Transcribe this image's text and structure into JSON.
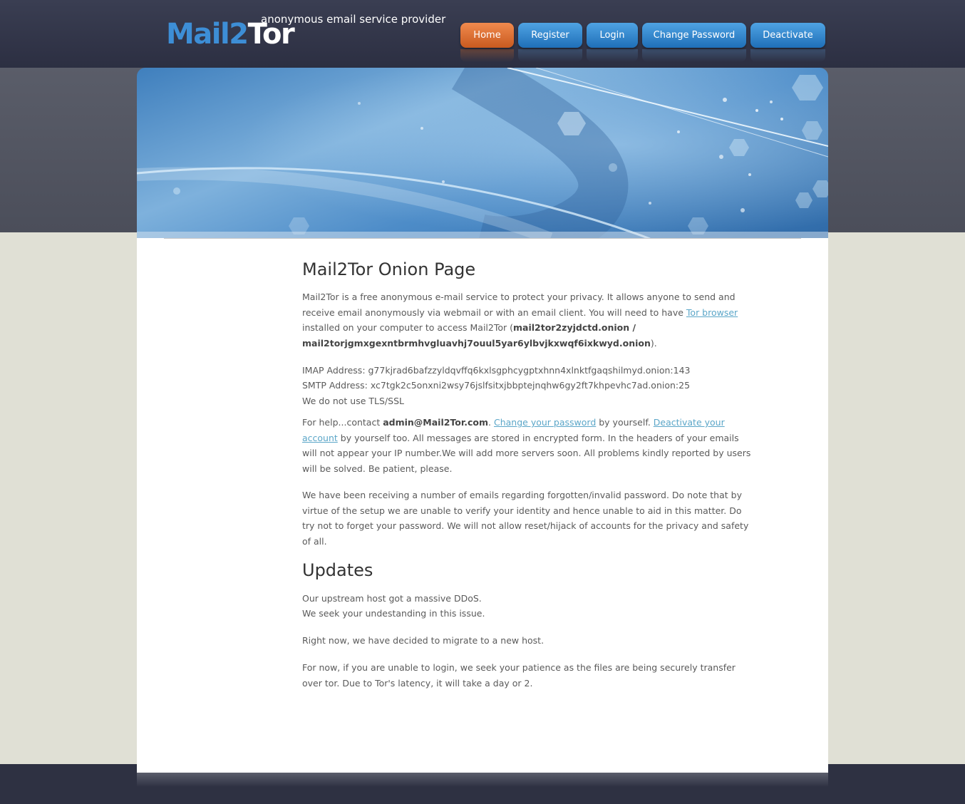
{
  "header": {
    "logo_part1": "Mail2",
    "logo_part2": "Tor",
    "tagline": "anonymous email service provider"
  },
  "nav": {
    "items": [
      {
        "label": "Home",
        "active": true
      },
      {
        "label": "Register",
        "active": false
      },
      {
        "label": "Login",
        "active": false
      },
      {
        "label": "Change Password",
        "active": false
      },
      {
        "label": "Deactivate",
        "active": false
      }
    ]
  },
  "main": {
    "title": "Mail2Tor Onion Page",
    "intro": {
      "t1": "Mail2Tor is a free anonymous e-mail service to protect your privacy. It allows anyone to send and receive email anonymously via webmail or with an email client. You will need to have ",
      "tor_link": "Tor browser",
      "t2": " installed on your computer to access Mail2Tor (",
      "onions": "mail2tor2zyjdctd.onion / mail2torjgmxgexntbrmhvgluavhj7ouul5yar6ylbvjkxwqf6ixkwyd.onion",
      "t3": ")."
    },
    "imap": "IMAP Address: g77kjrad6bafzzyldqvffq6kxlsgphcygptxhnn4xlnktfgaqshilmyd.onion:143",
    "smtp": "SMTP Address: xc7tgk2c5onxni2wsy76jslfsitxjbbptejnqhw6gy2ft7khpevhc7ad.onion:25",
    "tls": "We do not use TLS/SSL",
    "help": {
      "t1": "For help...contact ",
      "email": "admin@Mail2Tor.com",
      "t2": ". ",
      "change_link": "Change your password",
      "t3": " by yourself. ",
      "deactivate_link": "Deactivate your account",
      "t4": " by yourself too. All messages are stored in encrypted form. In the headers of your emails will not appear your IP number.We will add more servers soon. All problems kindly reported by users will be solved. Be patient, please."
    },
    "password_notice": "We have been receiving a number of emails regarding forgotten/invalid password. Do note that by virtue of the setup we are unable to verify your identity and hence unable to aid in this matter. Do try not to forget your password. We will not allow reset/hijack of accounts for the privacy and safety of all."
  },
  "updates": {
    "title": "Updates",
    "line1": "Our upstream host got a massive DDoS.",
    "line2": "We seek your undestanding in this issue.",
    "migrate": "Right now, we have decided to migrate to a new host.",
    "login_notice": "For now, if you are unable to login, we seek your patience as the files are being securely transfer over tor. Due to Tor's latency, it will take a day or 2."
  }
}
